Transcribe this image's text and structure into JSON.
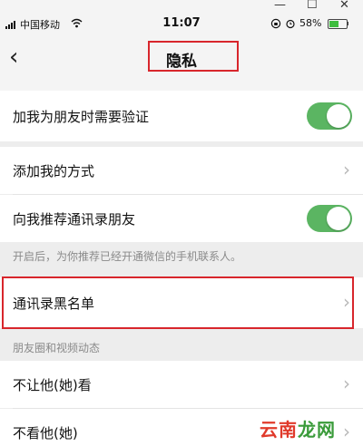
{
  "window": {
    "minimize": "—",
    "maximize": "☐",
    "close": "✕"
  },
  "status_bar": {
    "carrier": "中国移动",
    "time": "11:07",
    "battery_percent": "58%",
    "battery_level": 0.58
  },
  "nav": {
    "title": "隐私"
  },
  "settings": {
    "verify_friend": {
      "label": "加我为朋友时需要验证",
      "enabled": true
    },
    "add_methods": {
      "label": "添加我的方式"
    },
    "recommend_contacts": {
      "label": "向我推荐通讯录朋友",
      "enabled": true
    },
    "recommend_note": "开启后，为你推荐已经开通微信的手机联系人。",
    "contacts_blacklist": {
      "label": "通讯录黑名单"
    },
    "moments_section_header": "朋友圈和视频动态",
    "hide_my_posts": {
      "label": "不让他(她)看"
    },
    "hide_their_posts": {
      "label": "不看他(她)"
    }
  },
  "watermark": {
    "part1": "云南",
    "part2": "龙网"
  },
  "colors": {
    "toggle_on": "#5bb562",
    "highlight": "#d8262c",
    "background": "#ededed"
  }
}
